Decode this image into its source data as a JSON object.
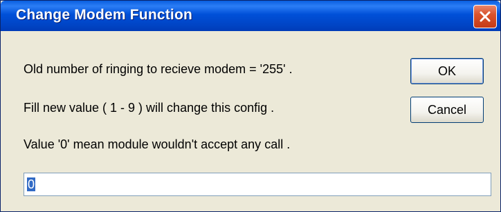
{
  "window": {
    "title": "Change Modem Function"
  },
  "messages": {
    "line1": "Old number of ringing to recieve modem = '255' .",
    "line2": "Fill new value ( 1 - 9 ) will change this config .",
    "line3": "Value '0' mean module wouldn't accept any call ."
  },
  "buttons": {
    "ok_label": "OK",
    "cancel_label": "Cancel"
  },
  "input": {
    "value": "0"
  },
  "icons": {
    "close": "close-icon"
  },
  "colors": {
    "titlebar": "#0050d8",
    "close_button": "#d9532c",
    "dialog_bg": "#ece9d8",
    "selection": "#316ac5"
  }
}
